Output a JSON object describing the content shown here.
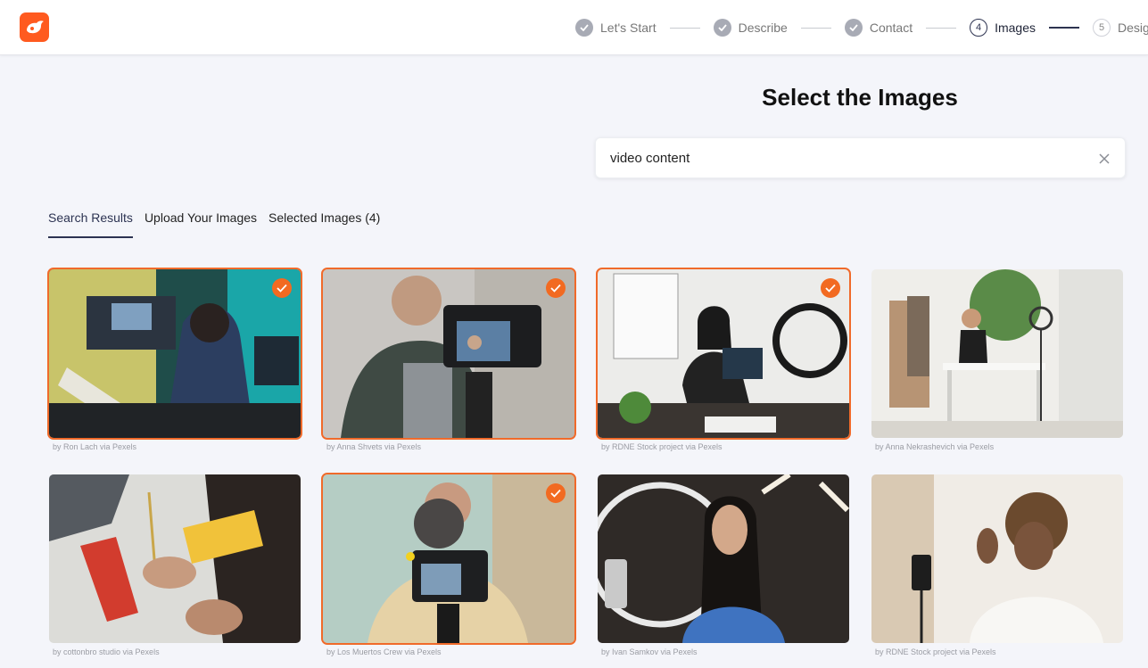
{
  "steps": [
    {
      "label": "Let's Start",
      "state": "done"
    },
    {
      "label": "Describe",
      "state": "done"
    },
    {
      "label": "Contact",
      "state": "done"
    },
    {
      "num": "4",
      "label": "Images",
      "state": "active"
    },
    {
      "num": "5",
      "label": "Design",
      "state": "todo"
    }
  ],
  "page_title": "Select the Images",
  "search": {
    "value": "video content"
  },
  "tabs": [
    "Search Results",
    "Upload Your Images",
    "Selected Images (4)"
  ],
  "images": [
    {
      "credit": "by Ron Lach via Pexels",
      "selected": true
    },
    {
      "credit": "by Anna Shvets via Pexels",
      "selected": true
    },
    {
      "credit": "by RDNE Stock project via Pexels",
      "selected": true
    },
    {
      "credit": "by Anna Nekrashevich via Pexels",
      "selected": false
    },
    {
      "credit": "by cottonbro studio via Pexels",
      "selected": false
    },
    {
      "credit": "by Los Muertos Crew via Pexels",
      "selected": true
    },
    {
      "credit": "by Ivan Samkov via Pexels",
      "selected": false
    },
    {
      "credit": "by RDNE Stock project via Pexels",
      "selected": false
    }
  ],
  "colors": {
    "accent": "#f26a21",
    "nav": "#2c3352"
  }
}
